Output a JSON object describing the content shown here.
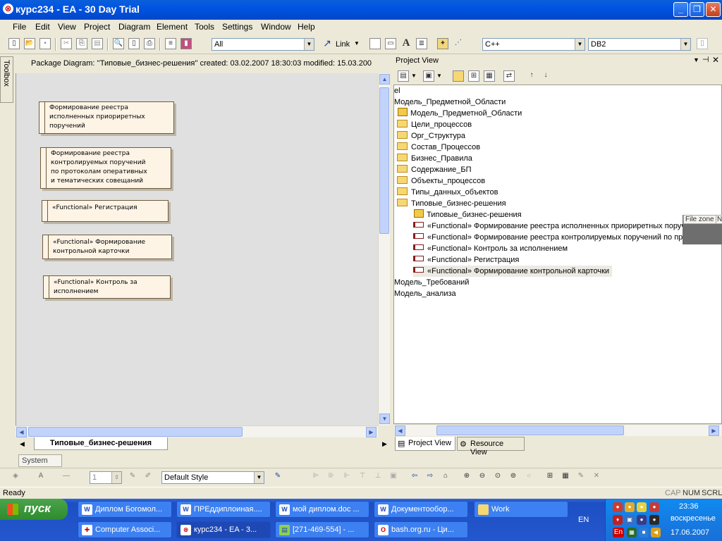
{
  "window": {
    "title": "курс234 - EA - 30 Day Trial",
    "app_icon": "ea-icon"
  },
  "menu": [
    "File",
    "Edit",
    "View",
    "Project",
    "Diagram",
    "Element",
    "Tools",
    "Settings",
    "Window",
    "Help"
  ],
  "toolbar": {
    "filter_value": "All",
    "link_label": "Link",
    "language_value": "C++",
    "database_value": "DB2"
  },
  "toolbox": {
    "label": "Toolbox"
  },
  "diagram": {
    "header": "Package Diagram: ''Типовые_бизнес-решения''   created: 03.02.2007 18:30:03  modified: 15.03.200",
    "tab_label": "Типовые_бизнес-решения",
    "elements": [
      {
        "line1": "Формирование реестра",
        "line2": "исполненных приориретных",
        "line3": "поручений",
        "line4": ""
      },
      {
        "line1": "Формирование реестра",
        "line2": "контролируемых поручений",
        "line3": "по протоколам оперативных",
        "line4": "и тематических совещаний"
      },
      {
        "line1": "«Functional» Регистрация",
        "line2": "",
        "line3": "",
        "line4": ""
      },
      {
        "line1": "«Functional» Формирование",
        "line2": "контрольной карточки",
        "line3": "",
        "line4": ""
      },
      {
        "line1": "«Functional» Контроль за",
        "line2": "исполнением",
        "line3": "",
        "line4": ""
      }
    ]
  },
  "project_view": {
    "title": "Project View",
    "tree": [
      "el",
      "Модель_Предметной_Области",
      "Модель_Предметной_Области",
      "Цели_процессов",
      "Орг_Структура",
      "Состав_Процессов",
      "Бизнес_Правила",
      "Содержание_БП",
      "Объекты_процессов",
      "Типы_данных_объектов",
      "Типовые_бизнес-решения",
      "Типовые_бизнес-решения",
      "«Functional» Формирование реестра исполненных приориретных поручений",
      "«Functional» Формирование реестра контролируемых поручений по протоколам оп",
      "«Functional» Контроль за исполнением",
      "«Functional» Регистрация",
      "«Functional» Формирование контрольной карточки",
      "Модель_Требований",
      "Модель_анализа"
    ],
    "file_zone_label": "File zone",
    "file_zone_col2": "N",
    "tabs": [
      "Project View",
      "Resource View"
    ]
  },
  "bottom_toolbar": {
    "system_tab": "System",
    "line_width": "1",
    "style_value": "Default Style"
  },
  "status": {
    "text": "Ready",
    "caps": "CAP",
    "num": "NUM",
    "scrl": "SCRL"
  },
  "taskbar": {
    "start_label": "пуск",
    "row1": [
      "Диплом Богомол...",
      "ПРЕддиплоиная....",
      "мой диплом.doc ...",
      "Документообор...",
      "Work"
    ],
    "row2": [
      "Computer Associ...",
      "курс234 - EA - 3...",
      "[271-469-554] - ...",
      "bash.org.ru - Ци..."
    ],
    "lang": "EN",
    "clock_time": "23:36",
    "clock_day": "воскресенье",
    "clock_date": "17.06.2007",
    "tray_lang": "En"
  }
}
